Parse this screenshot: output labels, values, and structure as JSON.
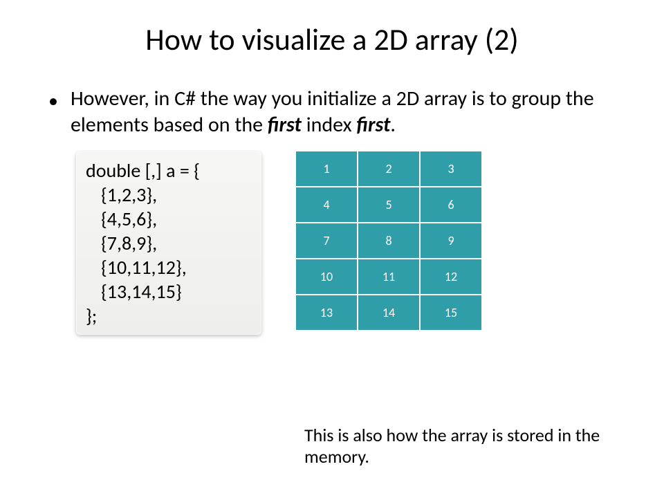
{
  "title": "How to visualize a 2D array (2)",
  "bullet": {
    "pre": "However, in C# the way you initialize a 2D array is to group the elements based on the ",
    "em1": "first",
    "mid": " index ",
    "em2": "first",
    "post": "."
  },
  "code": {
    "l0": "double [,] a = {",
    "l1": "{1,2,3},",
    "l2": "{4,5,6},",
    "l3": "{7,8,9},",
    "l4": "{10,11,12},",
    "l5": "{13,14,15}",
    "l6": "};"
  },
  "grid": {
    "rows": [
      [
        "1",
        "2",
        "3"
      ],
      [
        "4",
        "5",
        "6"
      ],
      [
        "7",
        "8",
        "9"
      ],
      [
        "10",
        "11",
        "12"
      ],
      [
        "13",
        "14",
        "15"
      ]
    ]
  },
  "caption": "This is also how the array is stored in the memory."
}
